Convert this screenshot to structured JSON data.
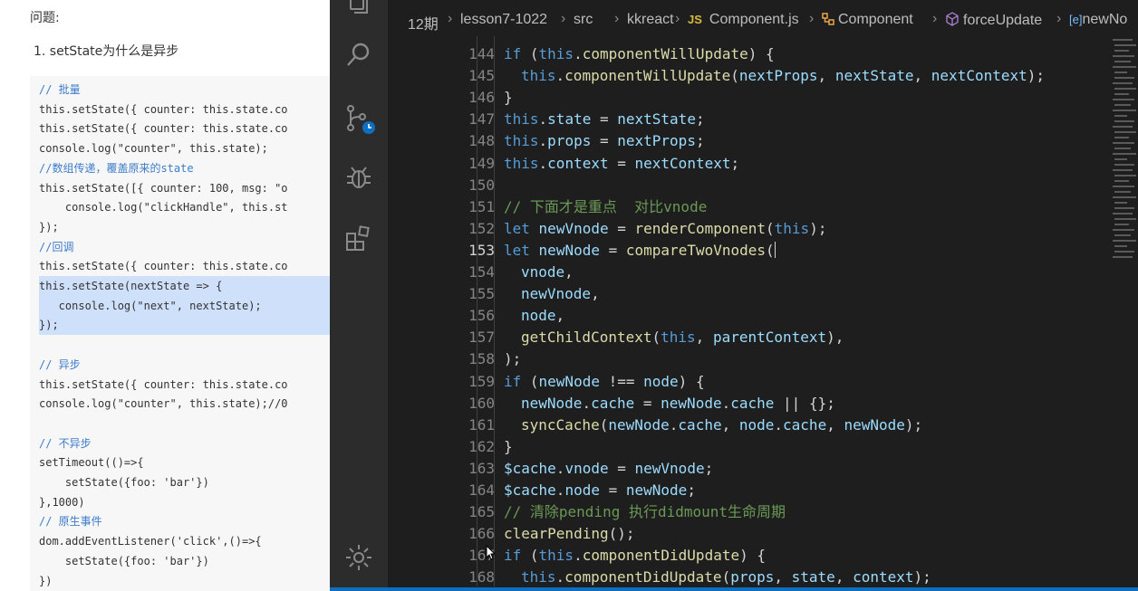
{
  "doc": {
    "heading": "问题:",
    "item": "1. setState为什么是异步",
    "code_lines": [
      {
        "text": "// 批量",
        "color": "#3d7cc9"
      },
      {
        "text": "this.setState({ counter: this.state.co",
        "color": "#333333"
      },
      {
        "text": "this.setState({ counter: this.state.co",
        "color": "#333333"
      },
      {
        "text": "console.log(\"counter\", this.state);",
        "color": "#333333"
      },
      {
        "text": "//数组传递，覆盖原来的state",
        "color": "#3d7cc9"
      },
      {
        "text": "this.setState([{ counter: 100, msg: \"o",
        "color": "#333333"
      },
      {
        "text": "    console.log(\"clickHandle\", this.st",
        "color": "#333333"
      },
      {
        "text": "});",
        "color": "#333333"
      },
      {
        "text": "//回调",
        "color": "#3d7cc9"
      },
      {
        "text": "this.setState({ counter: this.state.co",
        "color": "#333333"
      },
      {
        "text": "this.setState(nextState => {",
        "color": "#333333",
        "highlight": true
      },
      {
        "text": "   console.log(\"next\", nextState);",
        "color": "#333333",
        "highlight": true
      },
      {
        "text": "});",
        "color": "#333333",
        "highlight": true
      },
      {
        "text": "",
        "color": "#333333"
      },
      {
        "text": "// 异步",
        "color": "#3d7cc9"
      },
      {
        "text": "this.setState({ counter: this.state.co",
        "color": "#333333"
      },
      {
        "text": "console.log(\"counter\", this.state);//0",
        "color": "#333333"
      },
      {
        "text": "",
        "color": "#333333"
      },
      {
        "text": "// 不异步",
        "color": "#3d7cc9"
      },
      {
        "text": "setTimeout(()=>{",
        "color": "#333333"
      },
      {
        "text": "    setState({foo: 'bar'})",
        "color": "#333333"
      },
      {
        "text": "},1000)",
        "color": "#333333"
      },
      {
        "text": "// 原生事件",
        "color": "#3d7cc9"
      },
      {
        "text": "dom.addEventListener('click',()=>{",
        "color": "#333333"
      },
      {
        "text": "    setState({foo: 'bar'})",
        "color": "#333333"
      },
      {
        "text": "})",
        "color": "#333333"
      }
    ]
  },
  "breadcrumb": [
    {
      "label": "12期",
      "icon": ""
    },
    {
      "label": "lesson7-1022",
      "icon": ""
    },
    {
      "label": "src",
      "icon": ""
    },
    {
      "label": "kkreact",
      "icon": ""
    },
    {
      "label": "Component.js",
      "icon": "JS"
    },
    {
      "label": "Component",
      "icon": "class-icon"
    },
    {
      "label": "forceUpdate",
      "icon": "method-icon"
    },
    {
      "label": "newNo",
      "icon": "[e]"
    }
  ],
  "editor": {
    "active_line": 153,
    "lines": [
      {
        "num": 144,
        "indent": 0,
        "tokens": [
          [
            "kw",
            "if"
          ],
          [
            "op",
            " ("
          ],
          [
            "this",
            "this"
          ],
          [
            "op",
            "."
          ],
          [
            "fn",
            "componentWillUpdate"
          ],
          [
            "op",
            ") {"
          ]
        ]
      },
      {
        "num": 145,
        "indent": 1,
        "tokens": [
          [
            "this",
            "this"
          ],
          [
            "op",
            "."
          ],
          [
            "fn",
            "componentWillUpdate"
          ],
          [
            "op",
            "("
          ],
          [
            "var",
            "nextProps"
          ],
          [
            "op",
            ", "
          ],
          [
            "var",
            "nextState"
          ],
          [
            "op",
            ", "
          ],
          [
            "var",
            "nextContext"
          ],
          [
            "op",
            ");"
          ]
        ]
      },
      {
        "num": 146,
        "indent": 0,
        "tokens": [
          [
            "op",
            "}"
          ]
        ]
      },
      {
        "num": 147,
        "indent": 0,
        "tokens": [
          [
            "this",
            "this"
          ],
          [
            "op",
            "."
          ],
          [
            "var",
            "state"
          ],
          [
            "op",
            " = "
          ],
          [
            "var",
            "nextState"
          ],
          [
            "op",
            ";"
          ]
        ]
      },
      {
        "num": 148,
        "indent": 0,
        "tokens": [
          [
            "this",
            "this"
          ],
          [
            "op",
            "."
          ],
          [
            "var",
            "props"
          ],
          [
            "op",
            " = "
          ],
          [
            "var",
            "nextProps"
          ],
          [
            "op",
            ";"
          ]
        ]
      },
      {
        "num": 149,
        "indent": 0,
        "tokens": [
          [
            "this",
            "this"
          ],
          [
            "op",
            "."
          ],
          [
            "var",
            "context"
          ],
          [
            "op",
            " = "
          ],
          [
            "var",
            "nextContext"
          ],
          [
            "op",
            ";"
          ]
        ]
      },
      {
        "num": 150,
        "indent": 0,
        "tokens": []
      },
      {
        "num": 151,
        "indent": 0,
        "tokens": [
          [
            "com",
            "// 下面才是重点  对比vnode"
          ]
        ]
      },
      {
        "num": 152,
        "indent": 0,
        "tokens": [
          [
            "kw",
            "let"
          ],
          [
            "op",
            " "
          ],
          [
            "var",
            "newVnode"
          ],
          [
            "op",
            " = "
          ],
          [
            "fn",
            "renderComponent"
          ],
          [
            "op",
            "("
          ],
          [
            "this",
            "this"
          ],
          [
            "op",
            ");"
          ]
        ]
      },
      {
        "num": 153,
        "indent": 0,
        "tokens": [
          [
            "kw",
            "let"
          ],
          [
            "op",
            " "
          ],
          [
            "var",
            "newNode"
          ],
          [
            "op",
            " = "
          ],
          [
            "fn",
            "compareTwoVnodes"
          ],
          [
            "op",
            "("
          ]
        ]
      },
      {
        "num": 154,
        "indent": 1,
        "tokens": [
          [
            "var",
            "vnode"
          ],
          [
            "op",
            ","
          ]
        ]
      },
      {
        "num": 155,
        "indent": 1,
        "tokens": [
          [
            "var",
            "newVnode"
          ],
          [
            "op",
            ","
          ]
        ]
      },
      {
        "num": 156,
        "indent": 1,
        "tokens": [
          [
            "var",
            "node"
          ],
          [
            "op",
            ","
          ]
        ]
      },
      {
        "num": 157,
        "indent": 1,
        "tokens": [
          [
            "fn",
            "getChildContext"
          ],
          [
            "op",
            "("
          ],
          [
            "this",
            "this"
          ],
          [
            "op",
            ", "
          ],
          [
            "var",
            "parentContext"
          ],
          [
            "op",
            "),"
          ]
        ]
      },
      {
        "num": 158,
        "indent": 0,
        "tokens": [
          [
            "op",
            ");"
          ]
        ]
      },
      {
        "num": 159,
        "indent": 0,
        "tokens": [
          [
            "kw",
            "if"
          ],
          [
            "op",
            " ("
          ],
          [
            "var",
            "newNode"
          ],
          [
            "op",
            " !== "
          ],
          [
            "var",
            "node"
          ],
          [
            "op",
            ") {"
          ]
        ]
      },
      {
        "num": 160,
        "indent": 1,
        "tokens": [
          [
            "var",
            "newNode"
          ],
          [
            "op",
            "."
          ],
          [
            "var",
            "cache"
          ],
          [
            "op",
            " = "
          ],
          [
            "var",
            "newNode"
          ],
          [
            "op",
            "."
          ],
          [
            "var",
            "cache"
          ],
          [
            "op",
            " || {};"
          ]
        ]
      },
      {
        "num": 161,
        "indent": 1,
        "tokens": [
          [
            "fn",
            "syncCache"
          ],
          [
            "op",
            "("
          ],
          [
            "var",
            "newNode"
          ],
          [
            "op",
            "."
          ],
          [
            "var",
            "cache"
          ],
          [
            "op",
            ", "
          ],
          [
            "var",
            "node"
          ],
          [
            "op",
            "."
          ],
          [
            "var",
            "cache"
          ],
          [
            "op",
            ", "
          ],
          [
            "var",
            "newNode"
          ],
          [
            "op",
            ");"
          ]
        ]
      },
      {
        "num": 162,
        "indent": 0,
        "tokens": [
          [
            "op",
            "}"
          ]
        ]
      },
      {
        "num": 163,
        "indent": 0,
        "tokens": [
          [
            "var",
            "$cache"
          ],
          [
            "op",
            "."
          ],
          [
            "var",
            "vnode"
          ],
          [
            "op",
            " = "
          ],
          [
            "var",
            "newVnode"
          ],
          [
            "op",
            ";"
          ]
        ]
      },
      {
        "num": 164,
        "indent": 0,
        "tokens": [
          [
            "var",
            "$cache"
          ],
          [
            "op",
            "."
          ],
          [
            "var",
            "node"
          ],
          [
            "op",
            " = "
          ],
          [
            "var",
            "newNode"
          ],
          [
            "op",
            ";"
          ]
        ]
      },
      {
        "num": 165,
        "indent": 0,
        "tokens": [
          [
            "com",
            "// 清除pending 执行didmount生命周期"
          ]
        ]
      },
      {
        "num": 166,
        "indent": 0,
        "tokens": [
          [
            "fn",
            "clearPending"
          ],
          [
            "op",
            "();"
          ]
        ]
      },
      {
        "num": 167,
        "indent": 0,
        "tokens": [
          [
            "kw",
            "if"
          ],
          [
            "op",
            " ("
          ],
          [
            "this",
            "this"
          ],
          [
            "op",
            "."
          ],
          [
            "fn",
            "componentDidUpdate"
          ],
          [
            "op",
            ") {"
          ]
        ]
      },
      {
        "num": 168,
        "indent": 1,
        "tokens": [
          [
            "this",
            "this"
          ],
          [
            "op",
            "."
          ],
          [
            "fn",
            "componentDidUpdate"
          ],
          [
            "op",
            "("
          ],
          [
            "var",
            "props"
          ],
          [
            "op",
            ", "
          ],
          [
            "var",
            "state"
          ],
          [
            "op",
            ", "
          ],
          [
            "var",
            "context"
          ],
          [
            "op",
            ");"
          ]
        ]
      }
    ]
  },
  "activity_icons": [
    "explorer-icon",
    "search-icon",
    "source-control-icon",
    "debug-icon",
    "extensions-icon",
    "settings-gear-icon"
  ],
  "colors": {
    "editor_bg": "#1e1e1e",
    "activity_bg": "#2c2c2c",
    "status_bar": "#0e6fc1",
    "doc_code_bg": "#f7f7f8",
    "doc_highlight": "#cfe0fb"
  }
}
